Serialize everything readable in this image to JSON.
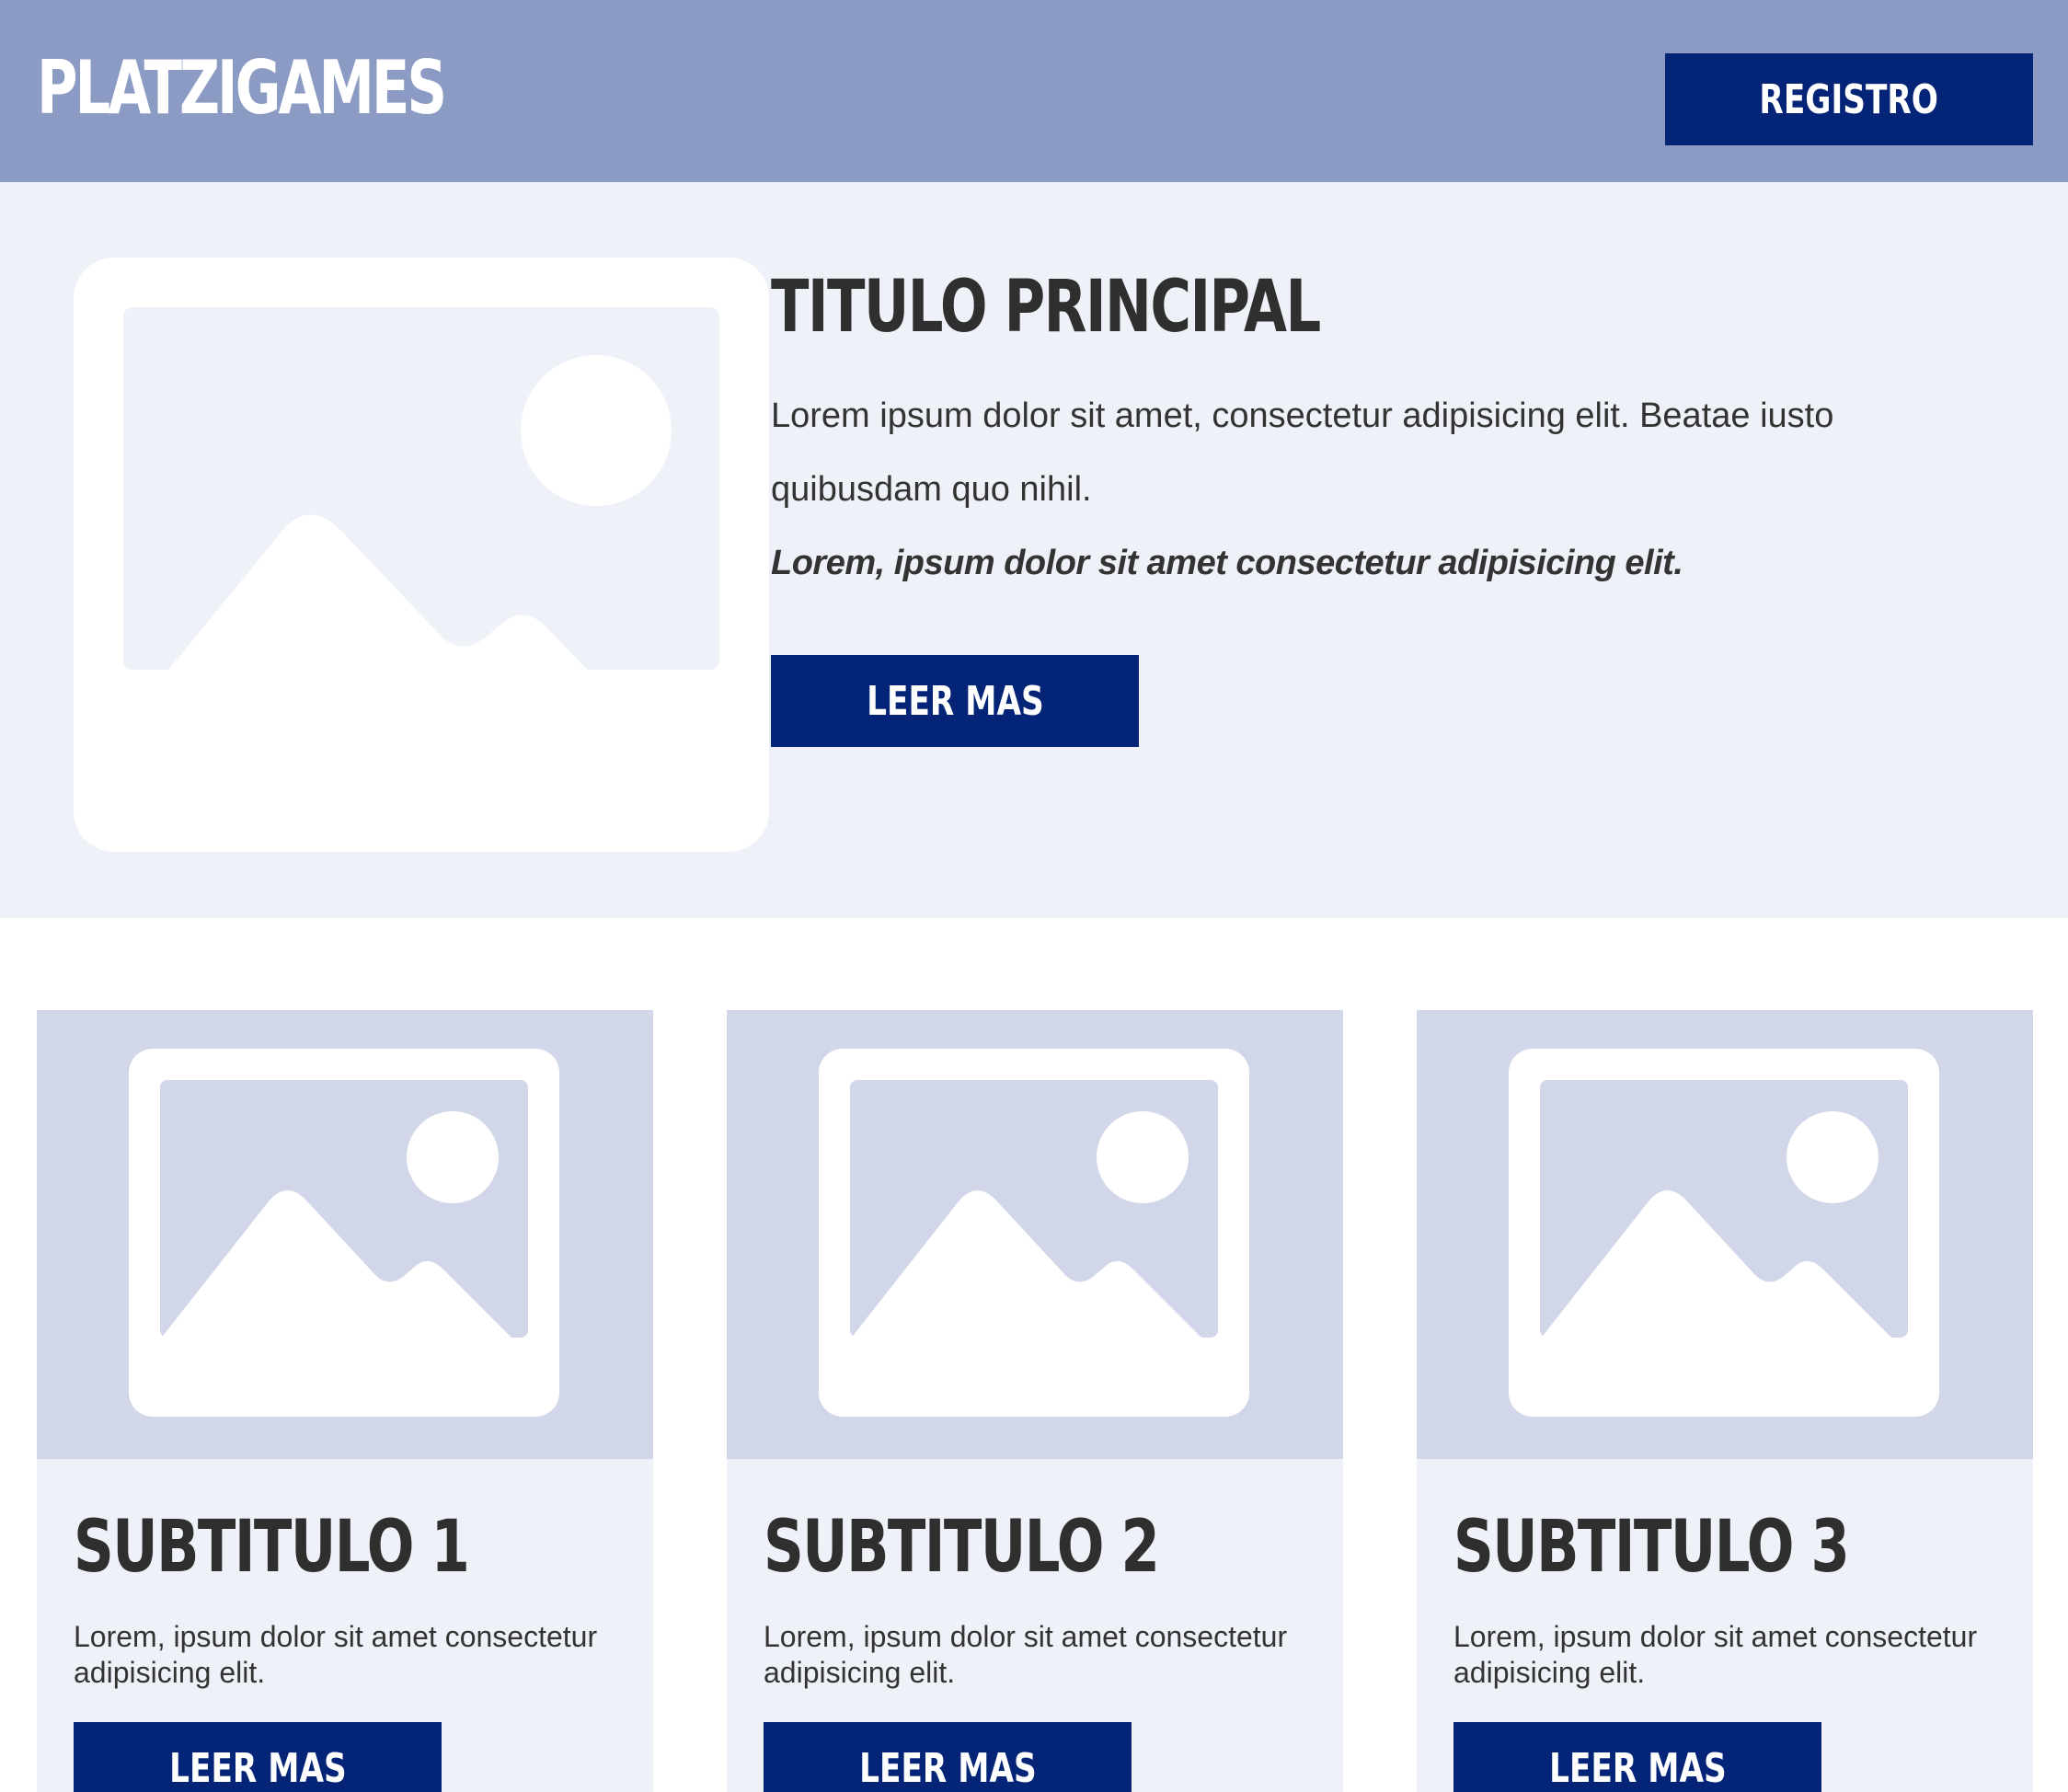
{
  "header": {
    "logo": "PLATZIGAMES",
    "register_label": "REGISTRO"
  },
  "hero": {
    "title": "TITULO PRINCIPAL",
    "paragraph_line1": "Lorem ipsum dolor sit amet, consectetur adipisicing elit. Beatae iusto",
    "paragraph_line2": "quibusdam quo nihil.",
    "emphasis": "Lorem, ipsum dolor sit amet consectetur adipisicing elit.",
    "button_label": "LEER MAS",
    "image_icon": "image-placeholder-icon"
  },
  "cards": [
    {
      "title": "SUBTITULO 1",
      "text": "Lorem, ipsum dolor sit amet consectetur adipisicing elit.",
      "button_label": "LEER MAS",
      "image_icon": "image-placeholder-icon"
    },
    {
      "title": "SUBTITULO 2",
      "text": "Lorem, ipsum dolor sit amet consectetur adipisicing elit.",
      "button_label": "LEER MAS",
      "image_icon": "image-placeholder-icon"
    },
    {
      "title": "SUBTITULO 3",
      "text": "Lorem, ipsum dolor sit amet consectetur adipisicing elit.",
      "button_label": "LEER MAS",
      "image_icon": "image-placeholder-icon"
    }
  ],
  "colors": {
    "header_bg": "#8b9bc3",
    "accent": "#042477",
    "section_bg": "#eef1f8",
    "card_media_bg": "#d1d7e9",
    "text": "#2f2f2f"
  }
}
